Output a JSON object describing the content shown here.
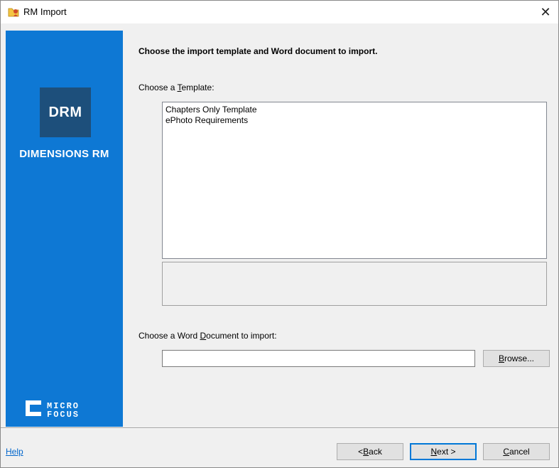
{
  "window": {
    "title": "RM Import",
    "close_glyph": "✕",
    "app_icon": "rm-import-icon"
  },
  "sidebar": {
    "background": "#0e78d4",
    "product_badge": "DRM",
    "product_name": "DIMENSIONS RM",
    "vendor_logo_top": "MICRO",
    "vendor_logo_bottom": "FOCUS"
  },
  "main": {
    "heading": "Choose the import template and Word document to import.",
    "template_label_pre": "Choose a ",
    "template_label_key": "T",
    "template_label_post": "emplate:",
    "templates": [
      "Chapters Only Template",
      "ePhoto Requirements"
    ],
    "template_description": "",
    "doc_label_pre": "Choose a Word ",
    "doc_label_key": "D",
    "doc_label_post": "ocument to import:",
    "doc_path_value": "",
    "browse_pre": "B",
    "browse_post": "rowse..."
  },
  "footer": {
    "help_label": "Help",
    "back_pre": "< ",
    "back_key": "B",
    "back_post": "ack",
    "next_key": "N",
    "next_post": "ext >",
    "cancel_key": "C",
    "cancel_post": "ancel"
  }
}
